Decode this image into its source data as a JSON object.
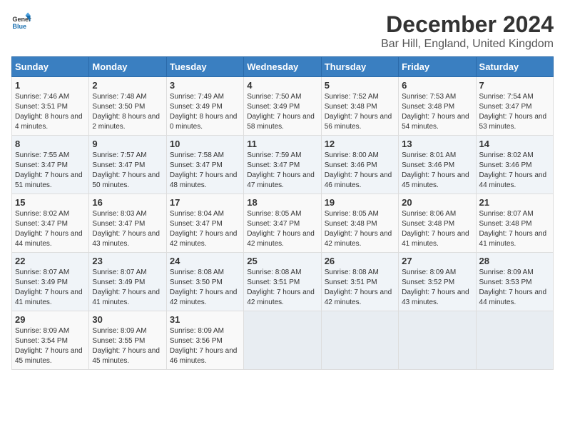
{
  "logo": {
    "general": "General",
    "blue": "Blue"
  },
  "title": "December 2024",
  "subtitle": "Bar Hill, England, United Kingdom",
  "columns": [
    "Sunday",
    "Monday",
    "Tuesday",
    "Wednesday",
    "Thursday",
    "Friday",
    "Saturday"
  ],
  "weeks": [
    [
      {
        "day": "1",
        "sunrise": "Sunrise: 7:46 AM",
        "sunset": "Sunset: 3:51 PM",
        "daylight": "Daylight: 8 hours and 4 minutes."
      },
      {
        "day": "2",
        "sunrise": "Sunrise: 7:48 AM",
        "sunset": "Sunset: 3:50 PM",
        "daylight": "Daylight: 8 hours and 2 minutes."
      },
      {
        "day": "3",
        "sunrise": "Sunrise: 7:49 AM",
        "sunset": "Sunset: 3:49 PM",
        "daylight": "Daylight: 8 hours and 0 minutes."
      },
      {
        "day": "4",
        "sunrise": "Sunrise: 7:50 AM",
        "sunset": "Sunset: 3:49 PM",
        "daylight": "Daylight: 7 hours and 58 minutes."
      },
      {
        "day": "5",
        "sunrise": "Sunrise: 7:52 AM",
        "sunset": "Sunset: 3:48 PM",
        "daylight": "Daylight: 7 hours and 56 minutes."
      },
      {
        "day": "6",
        "sunrise": "Sunrise: 7:53 AM",
        "sunset": "Sunset: 3:48 PM",
        "daylight": "Daylight: 7 hours and 54 minutes."
      },
      {
        "day": "7",
        "sunrise": "Sunrise: 7:54 AM",
        "sunset": "Sunset: 3:47 PM",
        "daylight": "Daylight: 7 hours and 53 minutes."
      }
    ],
    [
      {
        "day": "8",
        "sunrise": "Sunrise: 7:55 AM",
        "sunset": "Sunset: 3:47 PM",
        "daylight": "Daylight: 7 hours and 51 minutes."
      },
      {
        "day": "9",
        "sunrise": "Sunrise: 7:57 AM",
        "sunset": "Sunset: 3:47 PM",
        "daylight": "Daylight: 7 hours and 50 minutes."
      },
      {
        "day": "10",
        "sunrise": "Sunrise: 7:58 AM",
        "sunset": "Sunset: 3:47 PM",
        "daylight": "Daylight: 7 hours and 48 minutes."
      },
      {
        "day": "11",
        "sunrise": "Sunrise: 7:59 AM",
        "sunset": "Sunset: 3:47 PM",
        "daylight": "Daylight: 7 hours and 47 minutes."
      },
      {
        "day": "12",
        "sunrise": "Sunrise: 8:00 AM",
        "sunset": "Sunset: 3:46 PM",
        "daylight": "Daylight: 7 hours and 46 minutes."
      },
      {
        "day": "13",
        "sunrise": "Sunrise: 8:01 AM",
        "sunset": "Sunset: 3:46 PM",
        "daylight": "Daylight: 7 hours and 45 minutes."
      },
      {
        "day": "14",
        "sunrise": "Sunrise: 8:02 AM",
        "sunset": "Sunset: 3:46 PM",
        "daylight": "Daylight: 7 hours and 44 minutes."
      }
    ],
    [
      {
        "day": "15",
        "sunrise": "Sunrise: 8:02 AM",
        "sunset": "Sunset: 3:47 PM",
        "daylight": "Daylight: 7 hours and 44 minutes."
      },
      {
        "day": "16",
        "sunrise": "Sunrise: 8:03 AM",
        "sunset": "Sunset: 3:47 PM",
        "daylight": "Daylight: 7 hours and 43 minutes."
      },
      {
        "day": "17",
        "sunrise": "Sunrise: 8:04 AM",
        "sunset": "Sunset: 3:47 PM",
        "daylight": "Daylight: 7 hours and 42 minutes."
      },
      {
        "day": "18",
        "sunrise": "Sunrise: 8:05 AM",
        "sunset": "Sunset: 3:47 PM",
        "daylight": "Daylight: 7 hours and 42 minutes."
      },
      {
        "day": "19",
        "sunrise": "Sunrise: 8:05 AM",
        "sunset": "Sunset: 3:48 PM",
        "daylight": "Daylight: 7 hours and 42 minutes."
      },
      {
        "day": "20",
        "sunrise": "Sunrise: 8:06 AM",
        "sunset": "Sunset: 3:48 PM",
        "daylight": "Daylight: 7 hours and 41 minutes."
      },
      {
        "day": "21",
        "sunrise": "Sunrise: 8:07 AM",
        "sunset": "Sunset: 3:48 PM",
        "daylight": "Daylight: 7 hours and 41 minutes."
      }
    ],
    [
      {
        "day": "22",
        "sunrise": "Sunrise: 8:07 AM",
        "sunset": "Sunset: 3:49 PM",
        "daylight": "Daylight: 7 hours and 41 minutes."
      },
      {
        "day": "23",
        "sunrise": "Sunrise: 8:07 AM",
        "sunset": "Sunset: 3:49 PM",
        "daylight": "Daylight: 7 hours and 41 minutes."
      },
      {
        "day": "24",
        "sunrise": "Sunrise: 8:08 AM",
        "sunset": "Sunset: 3:50 PM",
        "daylight": "Daylight: 7 hours and 42 minutes."
      },
      {
        "day": "25",
        "sunrise": "Sunrise: 8:08 AM",
        "sunset": "Sunset: 3:51 PM",
        "daylight": "Daylight: 7 hours and 42 minutes."
      },
      {
        "day": "26",
        "sunrise": "Sunrise: 8:08 AM",
        "sunset": "Sunset: 3:51 PM",
        "daylight": "Daylight: 7 hours and 42 minutes."
      },
      {
        "day": "27",
        "sunrise": "Sunrise: 8:09 AM",
        "sunset": "Sunset: 3:52 PM",
        "daylight": "Daylight: 7 hours and 43 minutes."
      },
      {
        "day": "28",
        "sunrise": "Sunrise: 8:09 AM",
        "sunset": "Sunset: 3:53 PM",
        "daylight": "Daylight: 7 hours and 44 minutes."
      }
    ],
    [
      {
        "day": "29",
        "sunrise": "Sunrise: 8:09 AM",
        "sunset": "Sunset: 3:54 PM",
        "daylight": "Daylight: 7 hours and 45 minutes."
      },
      {
        "day": "30",
        "sunrise": "Sunrise: 8:09 AM",
        "sunset": "Sunset: 3:55 PM",
        "daylight": "Daylight: 7 hours and 45 minutes."
      },
      {
        "day": "31",
        "sunrise": "Sunrise: 8:09 AM",
        "sunset": "Sunset: 3:56 PM",
        "daylight": "Daylight: 7 hours and 46 minutes."
      },
      null,
      null,
      null,
      null
    ]
  ]
}
